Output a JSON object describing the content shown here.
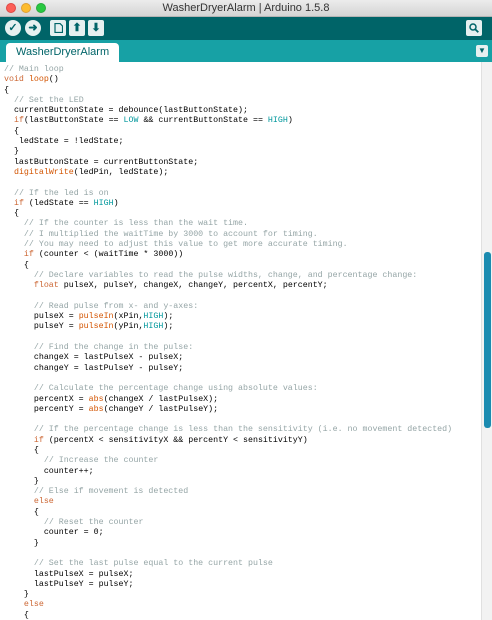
{
  "window": {
    "title": "WasherDryerAlarm | Arduino 1.5.8"
  },
  "toolbar": {
    "verify_icon": "check-icon",
    "upload_icon": "arrow-right-icon",
    "new_icon": "new-file-icon",
    "open_icon": "arrow-up-icon",
    "save_icon": "arrow-down-icon",
    "serial_monitor_icon": "magnifier-icon"
  },
  "tabs": [
    {
      "label": "WasherDryerAlarm",
      "active": true
    }
  ],
  "colors": {
    "toolbar_bg": "#006468",
    "tabs_bg": "#17a1a5",
    "comment": "#95a5a6",
    "keyword": "#cc6633",
    "function": "#d35400",
    "constant": "#00979c",
    "scroll_thumb": "#1b8bb0"
  },
  "code_lines": [
    [
      [
        "// Main loop",
        "cm"
      ]
    ],
    [
      [
        "void",
        "kw"
      ],
      [
        " "
      ],
      [
        "loop",
        "fn"
      ],
      [
        "()"
      ]
    ],
    [
      [
        "{"
      ]
    ],
    [
      [
        "  "
      ],
      [
        "// Set the LED",
        "cm"
      ]
    ],
    [
      [
        "  currentButtonState = debounce(lastButtonState);"
      ]
    ],
    [
      [
        "  "
      ],
      [
        "if",
        "kw"
      ],
      [
        "(lastButtonState == "
      ],
      [
        "LOW",
        "con"
      ],
      [
        " && currentButtonState == "
      ],
      [
        "HIGH",
        "con"
      ],
      [
        ")"
      ]
    ],
    [
      [
        "  {"
      ]
    ],
    [
      [
        "   ledState = !ledState;"
      ]
    ],
    [
      [
        "  }"
      ]
    ],
    [
      [
        "  lastButtonState = currentButtonState;"
      ]
    ],
    [
      [
        "  "
      ],
      [
        "digitalWrite",
        "fn"
      ],
      [
        "(ledPin, ledState);"
      ]
    ],
    [
      [
        ""
      ]
    ],
    [
      [
        "  "
      ],
      [
        "// If the led is on",
        "cm"
      ]
    ],
    [
      [
        "  "
      ],
      [
        "if",
        "kw"
      ],
      [
        " (ledState == "
      ],
      [
        "HIGH",
        "con"
      ],
      [
        ")"
      ]
    ],
    [
      [
        "  {"
      ]
    ],
    [
      [
        "    "
      ],
      [
        "// If the counter is less than the wait time.",
        "cm"
      ]
    ],
    [
      [
        "    "
      ],
      [
        "// I multiplied the waitTime by 3000 to account for timing.",
        "cm"
      ]
    ],
    [
      [
        "    "
      ],
      [
        "// You may need to adjust this value to get more accurate timing.",
        "cm"
      ]
    ],
    [
      [
        "    "
      ],
      [
        "if",
        "kw"
      ],
      [
        " (counter < (waitTime * 3000))"
      ]
    ],
    [
      [
        "    {"
      ]
    ],
    [
      [
        "      "
      ],
      [
        "// Declare variables to read the pulse widths, change, and percentage change:",
        "cm"
      ]
    ],
    [
      [
        "      "
      ],
      [
        "float",
        "kw"
      ],
      [
        " pulseX, pulseY, changeX, changeY, percentX, percentY;"
      ]
    ],
    [
      [
        ""
      ]
    ],
    [
      [
        "      "
      ],
      [
        "// Read pulse from x- and y-axes:",
        "cm"
      ]
    ],
    [
      [
        "      pulseX = "
      ],
      [
        "pulseIn",
        "fn"
      ],
      [
        "(xPin,"
      ],
      [
        "HIGH",
        "con"
      ],
      [
        ");"
      ]
    ],
    [
      [
        "      pulseY = "
      ],
      [
        "pulseIn",
        "fn"
      ],
      [
        "(yPin,"
      ],
      [
        "HIGH",
        "con"
      ],
      [
        ");"
      ]
    ],
    [
      [
        ""
      ]
    ],
    [
      [
        "      "
      ],
      [
        "// Find the change in the pulse:",
        "cm"
      ]
    ],
    [
      [
        "      changeX = lastPulseX - pulseX;"
      ]
    ],
    [
      [
        "      changeY = lastPulseY - pulseY;"
      ]
    ],
    [
      [
        ""
      ]
    ],
    [
      [
        "      "
      ],
      [
        "// Calculate the percentage change using absolute values:",
        "cm"
      ]
    ],
    [
      [
        "      percentX = "
      ],
      [
        "abs",
        "fn"
      ],
      [
        "(changeX / lastPulseX);"
      ]
    ],
    [
      [
        "      percentY = "
      ],
      [
        "abs",
        "fn"
      ],
      [
        "(changeY / lastPulseY);"
      ]
    ],
    [
      [
        ""
      ]
    ],
    [
      [
        "      "
      ],
      [
        "// If the percentage change is less than the sensitivity (i.e. no movement detected)",
        "cm"
      ]
    ],
    [
      [
        "      "
      ],
      [
        "if",
        "kw"
      ],
      [
        " (percentX < sensitivityX && percentY < sensitivityY)"
      ]
    ],
    [
      [
        "      {"
      ]
    ],
    [
      [
        "        "
      ],
      [
        "// Increase the counter",
        "cm"
      ]
    ],
    [
      [
        "        counter++;"
      ]
    ],
    [
      [
        "      }"
      ]
    ],
    [
      [
        "      "
      ],
      [
        "// Else if movement is detected",
        "cm"
      ]
    ],
    [
      [
        "      "
      ],
      [
        "else",
        "kw"
      ]
    ],
    [
      [
        "      {"
      ]
    ],
    [
      [
        "        "
      ],
      [
        "// Reset the counter",
        "cm"
      ]
    ],
    [
      [
        "        counter = 0;"
      ]
    ],
    [
      [
        "      }"
      ]
    ],
    [
      [
        ""
      ]
    ],
    [
      [
        "      "
      ],
      [
        "// Set the last pulse equal to the current pulse",
        "cm"
      ]
    ],
    [
      [
        "      lastPulseX = pulseX;"
      ]
    ],
    [
      [
        "      lastPulseY = pulseY;"
      ]
    ],
    [
      [
        "    }"
      ]
    ],
    [
      [
        "    "
      ],
      [
        "else",
        "kw"
      ]
    ],
    [
      [
        "    {"
      ]
    ]
  ]
}
